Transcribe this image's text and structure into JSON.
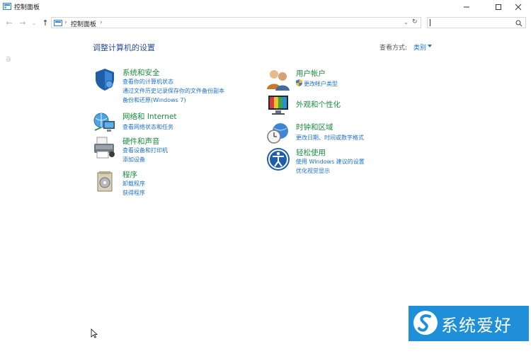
{
  "window": {
    "title": "控制面板"
  },
  "address": {
    "crumbs": [
      "控制面板"
    ]
  },
  "search": {
    "placeholder": ""
  },
  "page": {
    "title": "调整计算机的设置",
    "view_by_label": "查看方式:",
    "view_by_value": "类别"
  },
  "categories": [
    {
      "title": "系统和安全",
      "icon": "shield-icon",
      "links": [
        "查看你的计算机状态",
        "通过文件历史记录保存你的文件备份副本",
        "备份和还原(Windows 7)"
      ]
    },
    {
      "title": "网络和 Internet",
      "icon": "network-globe-icon",
      "links": [
        "查看网络状态和任务"
      ]
    },
    {
      "title": "硬件和声音",
      "icon": "printer-icon",
      "links": [
        "查看设备和打印机",
        "添加设备"
      ]
    },
    {
      "title": "程序",
      "icon": "programs-box-icon",
      "links": [
        "卸载程序",
        "获得程序"
      ]
    },
    {
      "title": "用户帐户",
      "icon": "users-icon",
      "links": [
        "更改帐户类型"
      ]
    },
    {
      "title": "外观和个性化",
      "icon": "monitor-icon",
      "links": []
    },
    {
      "title": "时钟和区域",
      "icon": "clock-globe-icon",
      "links": [
        "更改日期、时间或数字格式"
      ]
    },
    {
      "title": "轻松使用",
      "icon": "ease-of-access-icon",
      "links": [
        "使用 Windows 建议的设置",
        "优化视觉显示"
      ]
    }
  ],
  "watermark": {
    "text": "系统爱好者"
  },
  "colors": {
    "link": "#1e70c9",
    "category_heading": "#1a8c3e",
    "page_title": "#2a4e9b",
    "watermark_bg": "#1f8fd9"
  }
}
